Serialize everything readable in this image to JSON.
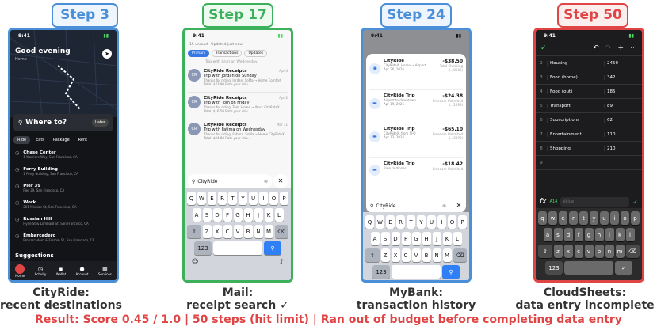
{
  "steps": [
    {
      "label": "Step 3",
      "color": "#4a8fd8",
      "caption1": "CityRide:",
      "caption2": "recent destinations"
    },
    {
      "label": "Step 17",
      "color": "#3cb05a",
      "caption1": "Mail:",
      "caption2": "receipt search ✓"
    },
    {
      "label": "Step 24",
      "color": "#4a8fd8",
      "caption1": "MyBank:",
      "caption2": "transaction history"
    },
    {
      "label": "Step 50",
      "color": "#e04545",
      "caption1": "CloudSheets:",
      "caption2": "data entry incomplete"
    }
  ],
  "result": "Result: Score 0.45 / 1.0  |  50 steps (hit limit)  |  Ran out of budget before completing data entry",
  "cityride": {
    "time": "9:41",
    "greeting": "Good evening",
    "home": "Home",
    "where_to": "Where to?",
    "later": "Later",
    "tabs": [
      "Ride",
      "Eats",
      "Package",
      "Rent"
    ],
    "destinations": [
      {
        "name": "Chase Center",
        "addr": "1 Warriors Way, San Francisco, CA"
      },
      {
        "name": "Ferry Building",
        "addr": "1 Ferry Building, San Francisco, CA"
      },
      {
        "name": "Pier 39",
        "addr": "Pier 39, San Francisco, CA"
      },
      {
        "name": "Work",
        "addr": "201 Mission St, San Francisco, CA"
      },
      {
        "name": "Russian Hill",
        "addr": "Hyde St & Lombard St, San Francisco, CA"
      },
      {
        "name": "Embarcadero",
        "addr": "Embarcadero & Folsom St, San Francisco, CA"
      }
    ],
    "suggestions": "Suggestions",
    "nav": [
      "Home",
      "Activity",
      "Wallet",
      "Account",
      "Services"
    ]
  },
  "mail": {
    "time": "9:41",
    "status": "15 unread · Updated just now",
    "tabs": [
      "Primary",
      "Transactions",
      "Updates"
    ],
    "top_line": "Trip with Arun on Wednesday",
    "items": [
      {
        "from": "CityRide Receipts",
        "subject": "Trip with Jordan on Sunday",
        "snippet": "Thanks for riding, Jordan. SoMa → Home Comfort Total: $23.90  Rate your driv...",
        "date": "Apr 4",
        "initials": "CR"
      },
      {
        "from": "CityRide Receipts",
        "subject": "Trip with Tom on Friday",
        "snippet": "Thanks for riding, Tom. Home → Work CityRideX Total: $16.50  Rate your driv...",
        "date": "Apr 2",
        "initials": "CR"
      },
      {
        "from": "CityRide Receipts",
        "subject": "Trip with Fatima on Wednesday",
        "snippet": "Thanks for riding, Fatima. SoMa → Home CityRideX Total: $24.88  Rate your driv...",
        "date": "Mar 31",
        "initials": "CR"
      }
    ],
    "search_value": "CityRide"
  },
  "bank": {
    "time": "9:41",
    "transactions": [
      {
        "title": "CityRide",
        "detail": "CityRideX, Home → Airport",
        "date": "Apr 26, 2026",
        "amount": "-$38.50",
        "account": "Total Checking (...8645)"
      },
      {
        "title": "CityRide Trip",
        "detail": "Airport to downtown",
        "date": "Apr 19, 2026",
        "amount": "-$24.38",
        "account": "Freedom Unlimited (...2090)"
      },
      {
        "title": "CityRide Trip",
        "detail": "CityRideX, from SFO",
        "date": "Apr 13, 2026",
        "amount": "-$65.10",
        "account": "Freedom Unlimited (...2090)"
      },
      {
        "title": "CityRide Trip",
        "detail": "Ride to dinner",
        "date": "",
        "amount": "-$18.42",
        "account": "Freedom Unlimited"
      }
    ],
    "search_value": "CityRide"
  },
  "sheets": {
    "time": "9:41",
    "rows": [
      {
        "n": "2",
        "cat": "Housing",
        "val": "2450"
      },
      {
        "n": "3",
        "cat": "Food (home)",
        "val": "342"
      },
      {
        "n": "4",
        "cat": "Food (out)",
        "val": "185"
      },
      {
        "n": "5",
        "cat": "Transport",
        "val": "89"
      },
      {
        "n": "6",
        "cat": "Subscriptions",
        "val": "62"
      },
      {
        "n": "7",
        "cat": "Entertainment",
        "val": "110"
      },
      {
        "n": "8",
        "cat": "Shopping",
        "val": "210"
      },
      {
        "n": "9",
        "cat": "",
        "val": ""
      }
    ],
    "cell_ref": "A14",
    "value_placeholder": "Value"
  },
  "keyboard": {
    "row1": [
      "Q",
      "W",
      "E",
      "R",
      "T",
      "Y",
      "U",
      "I",
      "O",
      "P"
    ],
    "row2": [
      "A",
      "S",
      "D",
      "F",
      "G",
      "H",
      "J",
      "K",
      "L"
    ],
    "row3": [
      "Z",
      "X",
      "C",
      "V",
      "B",
      "N",
      "M"
    ],
    "row1_lower": [
      "q",
      "w",
      "e",
      "r",
      "t",
      "y",
      "u",
      "i",
      "o",
      "p"
    ],
    "row2_lower": [
      "a",
      "s",
      "d",
      "f",
      "g",
      "h",
      "j",
      "k",
      "l"
    ],
    "row3_lower": [
      "z",
      "x",
      "c",
      "v",
      "b",
      "n",
      "m"
    ],
    "num": "123"
  }
}
